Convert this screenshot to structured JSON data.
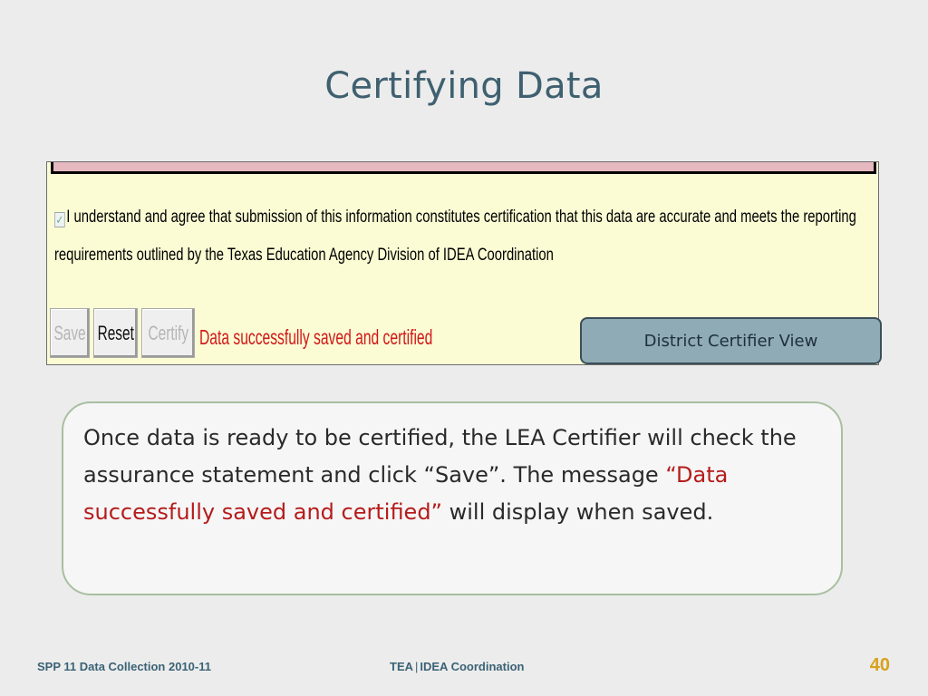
{
  "slide": {
    "title": "Certifying Data"
  },
  "screenshot": {
    "agreement_text": "I understand and agree that submission of this information constitutes certification that this data are accurate and meets the reporting requirements outlined by the Texas Education Agency Division of IDEA Coordination",
    "checkbox_checked": true,
    "buttons": {
      "save": "Save",
      "reset": "Reset",
      "certify": "Certify"
    },
    "status_message": "Data successfully saved and certified",
    "status_color": "#d01818",
    "bar_color": "#e6b8c0",
    "panel_bg": "#fbfbd4"
  },
  "callout": {
    "label": "District Certifier View"
  },
  "note": {
    "part1": "Once data is ready to be certified, the LEA Certifier will check the assurance statement and click “Save”.  The message ",
    "highlight": "“Data successfully saved and certified”",
    "part2": " will display when saved."
  },
  "footer": {
    "left": "SPP 11 Data Collection 2010-11",
    "center_a": "TEA",
    "center_b": "IDEA Coordination",
    "page": "40"
  }
}
